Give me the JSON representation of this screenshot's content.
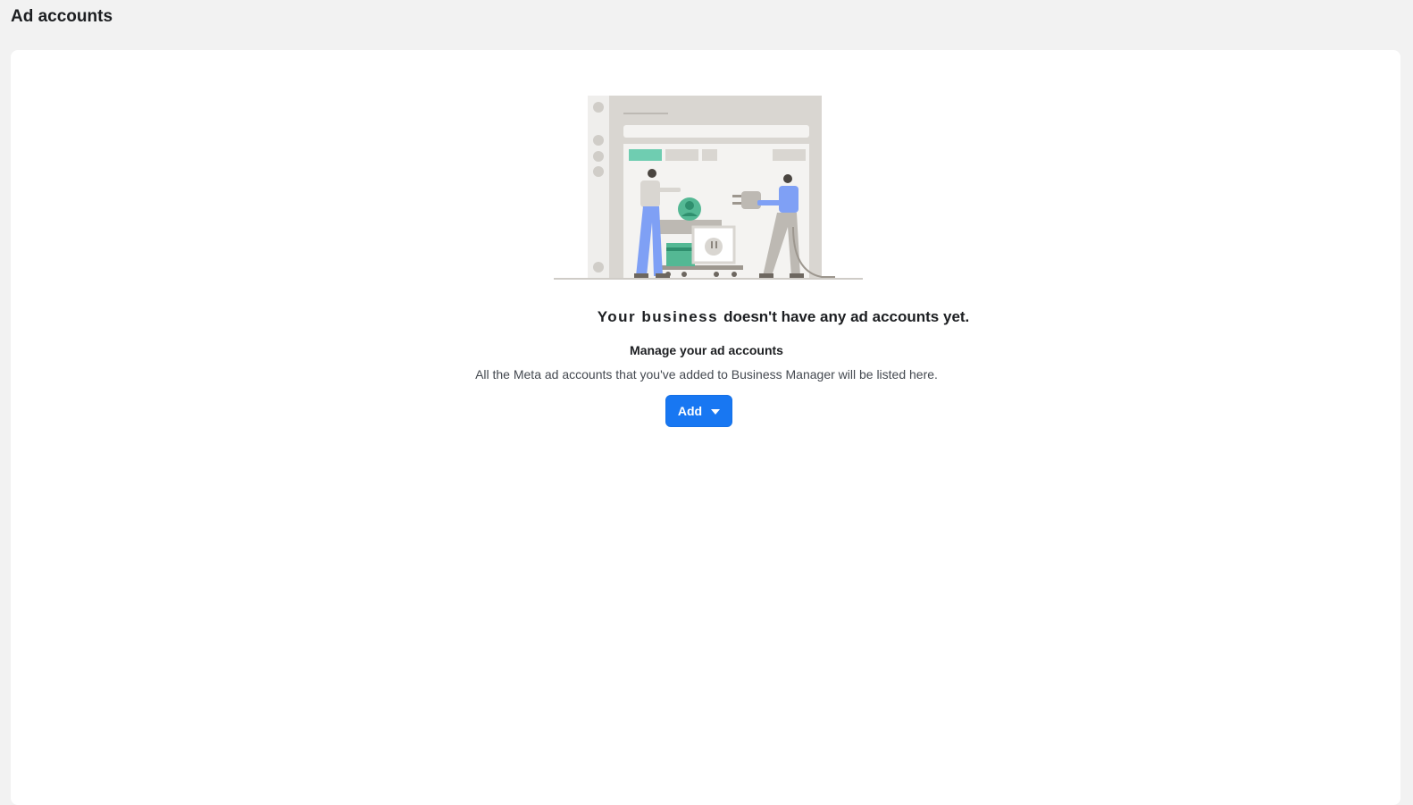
{
  "page": {
    "title": "Ad accounts"
  },
  "empty_state": {
    "business_name": "Your business",
    "headline_suffix": "doesn't have any ad accounts yet.",
    "subheading": "Manage your ad accounts",
    "description": "All the Meta ad accounts that you've added to Business Manager will be listed here.",
    "add_button_label": "Add",
    "add_button_icon": "caret-down-icon",
    "illustration": "people-connecting-plug-illustration"
  },
  "colors": {
    "page_background": "#f2f2f2",
    "card_background": "#ffffff",
    "primary_button": "#1877f2",
    "accent_green": "#5ec4a6",
    "accent_blue": "#7fa0f5"
  }
}
